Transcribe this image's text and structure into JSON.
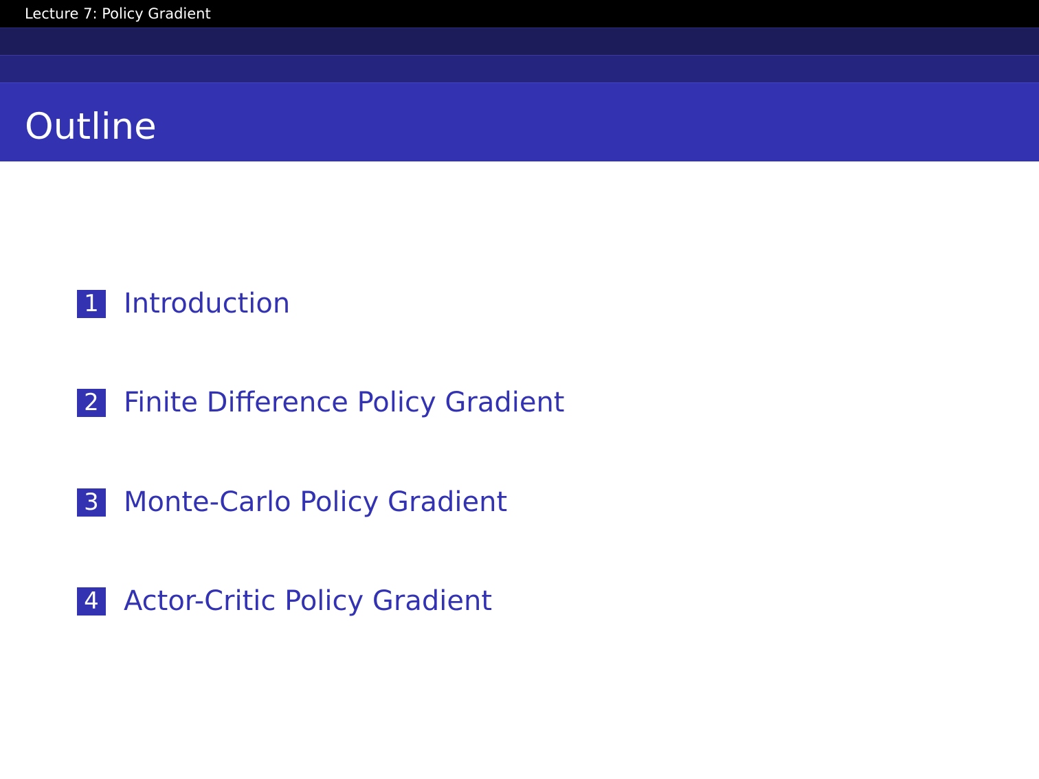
{
  "header": {
    "title": "Lecture 7:  Policy Gradient"
  },
  "frame": {
    "title": "Outline"
  },
  "outline": {
    "items": [
      {
        "number": "1",
        "label": "Introduction"
      },
      {
        "number": "2",
        "label": "Finite Difference Policy Gradient"
      },
      {
        "number": "3",
        "label": "Monte-Carlo Policy Gradient"
      },
      {
        "number": "4",
        "label": "Actor-Critic Policy Gradient"
      }
    ]
  },
  "colors": {
    "header_background": "#000000",
    "band_dark": "#1c1c5b",
    "band_mid": "#25257f",
    "title_bar": "#3333b2",
    "accent_text": "#3333b2",
    "white": "#ffffff"
  }
}
